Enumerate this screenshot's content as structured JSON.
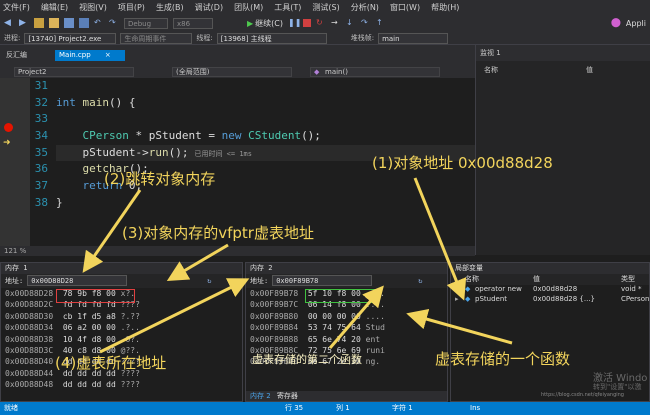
{
  "menu": [
    "文件(F)",
    "编辑(E)",
    "视图(V)",
    "项目(P)",
    "生成(B)",
    "调试(D)",
    "团队(M)",
    "工具(T)",
    "测试(S)",
    "分析(N)",
    "窗口(W)",
    "帮助(H)"
  ],
  "toolbar": {
    "config": "Debug",
    "platform": "x86",
    "continue_label": "继续(C)",
    "right_label": "Appli"
  },
  "procbar": {
    "process_label": "进程:",
    "process_value": "[13740] Project2.exe",
    "thread_label": "线程:",
    "thread_value": "[13968] 主线程",
    "stack_label": "堆栈帧:",
    "stack_value": "main",
    "lifecycle": "生命周期事件"
  },
  "tabs": {
    "left_pane": "反汇编",
    "editor": "Main.cpp",
    "watch": "监视 1"
  },
  "nav": {
    "project": "Project2",
    "scope": "(全局范围)",
    "func": "main()"
  },
  "code": {
    "lines": [
      "31",
      "32",
      "33",
      "34",
      "35",
      "36",
      "37",
      "38"
    ],
    "timing": "已用时间 <= 1ms"
  },
  "zoom": "121 %",
  "watch": {
    "col_name": "名称",
    "col_value": "值"
  },
  "memory1": {
    "title": "内存 1",
    "addr_label": "地址:",
    "addr_value": "0x00D88D28",
    "rows": [
      {
        "a": "0x00D88D28",
        "b": "78 9b f8 00",
        "c": "x?."
      },
      {
        "a": "0x00D88D2C",
        "b": "fd fd fd fd",
        "c": "????"
      },
      {
        "a": "0x00D88D30",
        "b": "cb 1f d5 a8",
        "c": "?.??"
      },
      {
        "a": "0x00D88D34",
        "b": "06 a2 00 00",
        "c": ".?.."
      },
      {
        "a": "0x00D88D38",
        "b": "10 4f d8 00",
        "c": ".O?."
      },
      {
        "a": "0x00D88D3C",
        "b": "40 c8 d8 00",
        "c": "@??."
      },
      {
        "a": "0x00D88D40",
        "b": "dd dd dd dd",
        "c": "????"
      },
      {
        "a": "0x00D88D44",
        "b": "dd dd dd dd",
        "c": "????"
      },
      {
        "a": "0x00D88D48",
        "b": "dd dd dd dd",
        "c": "????"
      }
    ]
  },
  "memory2": {
    "title": "内存 2",
    "addr_label": "地址:",
    "addr_value": "0x00F89B78",
    "rows": [
      {
        "a": "0x00F89B78",
        "b": "5f 10 f8 00",
        "c": "_.?."
      },
      {
        "a": "0x00F89B7C",
        "b": "06 14 f8 00",
        "c": "..?."
      },
      {
        "a": "0x00F89B80",
        "b": "00 00 00 00",
        "c": "...."
      },
      {
        "a": "0x00F89B84",
        "b": "53 74 75 64",
        "c": "Stud"
      },
      {
        "a": "0x00F89B88",
        "b": "65 6e 74 20",
        "c": "ent "
      },
      {
        "a": "0x00F89B8C",
        "b": "72 75 6e 69",
        "c": "runi"
      },
      {
        "a": "0x00F89B90",
        "b": "6e 67 2e 20",
        "c": "ng. "
      }
    ],
    "bottom_tabs": [
      "内存 2",
      "寄存器"
    ]
  },
  "locals": {
    "title": "局部变量",
    "col_name": "名称",
    "col_value": "值",
    "col_type": "类型",
    "rows": [
      {
        "name": "operator new",
        "value": "0x00d88d28",
        "type": "void *"
      },
      {
        "name": "pStudent",
        "value": "0x00d88d28 {...}",
        "type": "CPerson"
      }
    ],
    "watermark": "激活 Windo",
    "watermark2": "转到\"设置\"以激",
    "url": "https://blog.csdn.net/qfeiyanging"
  },
  "status": {
    "ready": "就绪",
    "line": "行 35",
    "col": "列 1",
    "char": "字符 1",
    "ins": "Ins"
  },
  "annotations": {
    "a1": "(1)对象地址  0x00d88d28",
    "a2": "(2)跳转对象内存",
    "a3": "(3)对象内存的vfptr虚表地址",
    "a4": "(4)虚表所在地址",
    "a5": "虚表存储的第二个函数",
    "a6": "虚表存储的一个函数"
  },
  "colors": {
    "accent": "#007acc",
    "annotation": "#f2d45c",
    "red_box": "#e04040",
    "green_box": "#40c040"
  }
}
